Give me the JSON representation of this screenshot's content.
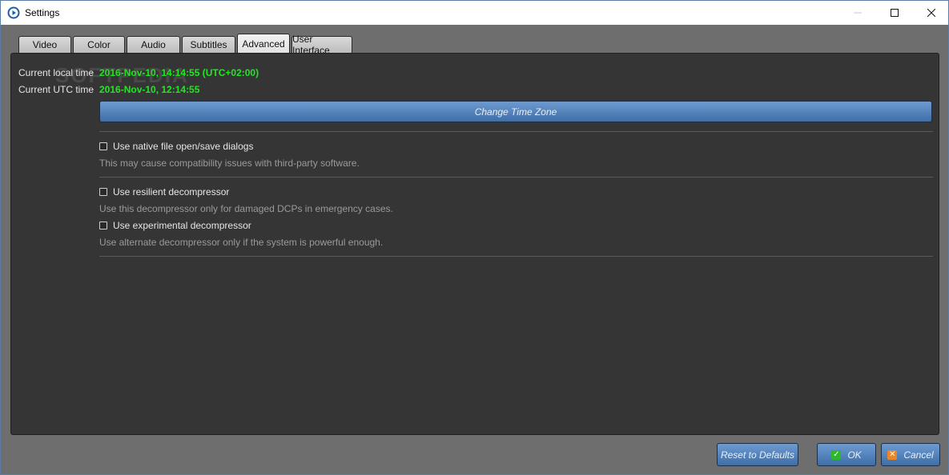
{
  "window": {
    "title": "Settings"
  },
  "tabs": [
    {
      "label": "Video"
    },
    {
      "label": "Color"
    },
    {
      "label": "Audio"
    },
    {
      "label": "Subtitles"
    },
    {
      "label": "Advanced",
      "active": true
    },
    {
      "label": "User Interface"
    }
  ],
  "time": {
    "local_label": "Current local time",
    "local_value": "2016-Nov-10, 14:14:55 (UTC+02:00)",
    "utc_label": "Current UTC time",
    "utc_value": "2016-Nov-10, 12:14:55",
    "change_tz_label": "Change Time Zone"
  },
  "watermark": "SOFTPEDIA",
  "options": {
    "native_dialogs": {
      "label": "Use native file open/save dialogs",
      "description": "This may cause compatibility issues with third-party software.",
      "checked": false
    },
    "resilient": {
      "label": "Use resilient decompressor",
      "description": "Use this decompressor only for damaged DCPs in emergency cases.",
      "checked": false
    },
    "experimental": {
      "label": "Use experimental decompressor",
      "description": "Use alternate decompressor only if the system is powerful enough.",
      "checked": false
    }
  },
  "buttons": {
    "reset_label": "Reset to Defaults",
    "ok_label": "OK",
    "cancel_label": "Cancel"
  },
  "colors": {
    "value_green": "#22e622",
    "accent_blue": "#4f80bd",
    "ok_icon": "#2eb82e",
    "cancel_icon": "#e8862a"
  },
  "icons": {
    "app": "play-circle-icon",
    "ok": "checkmark-icon",
    "cancel": "x-icon"
  }
}
